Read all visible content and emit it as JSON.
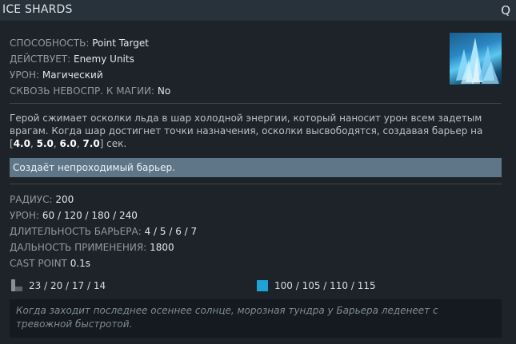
{
  "ability": {
    "name": "ICE SHARDS",
    "hotkey": "Q"
  },
  "stats": [
    {
      "label": "СПОСОБНОСТЬ:",
      "value": "Point Target"
    },
    {
      "label": "ДЕЙСТВУЕТ:",
      "value": "Enemy Units"
    },
    {
      "label": "УРОН:",
      "value": "Магический"
    },
    {
      "label": "СКВОЗЬ НЕВОСПР. К МАГИИ:",
      "value": "No"
    }
  ],
  "description": {
    "text": "Герой сжимает осколки льда в шар холодной энергии, который наносит урон всем задетым врагам. Когда шар достигнет точки назначения, осколки высвободятся, создавая барьер на [",
    "durations": [
      "4.0",
      "5.0",
      "6.0",
      "7.0"
    ],
    "sep": ", ",
    "suffix": "] сек."
  },
  "note": "Создаёт непроходимый барьер.",
  "attributes": [
    {
      "label": "РАДИУС:",
      "value": "200"
    },
    {
      "label": "УРОН:",
      "value": "60 / 120 / 180 / 240"
    },
    {
      "label": "ДЛИТЕЛЬНОСТЬ БАРЬЕРА:",
      "value": "4 / 5 / 6 / 7"
    },
    {
      "label": "ДАЛЬНОСТЬ ПРИМЕНЕНИЯ:",
      "value": "1800"
    },
    {
      "label": "CAST POINT",
      "value": "0.1s"
    }
  ],
  "cooldown": {
    "value": "23 / 20 / 17 / 14",
    "icon": "cooldown-icon"
  },
  "mana": {
    "value": "100 / 105 / 110 / 115",
    "icon": "mana-icon",
    "color": "#1da3d6"
  },
  "lore": "Когда заходит последнее осеннее солнце, морозная тундра у Барьера леденеет с тревожной быстротой."
}
